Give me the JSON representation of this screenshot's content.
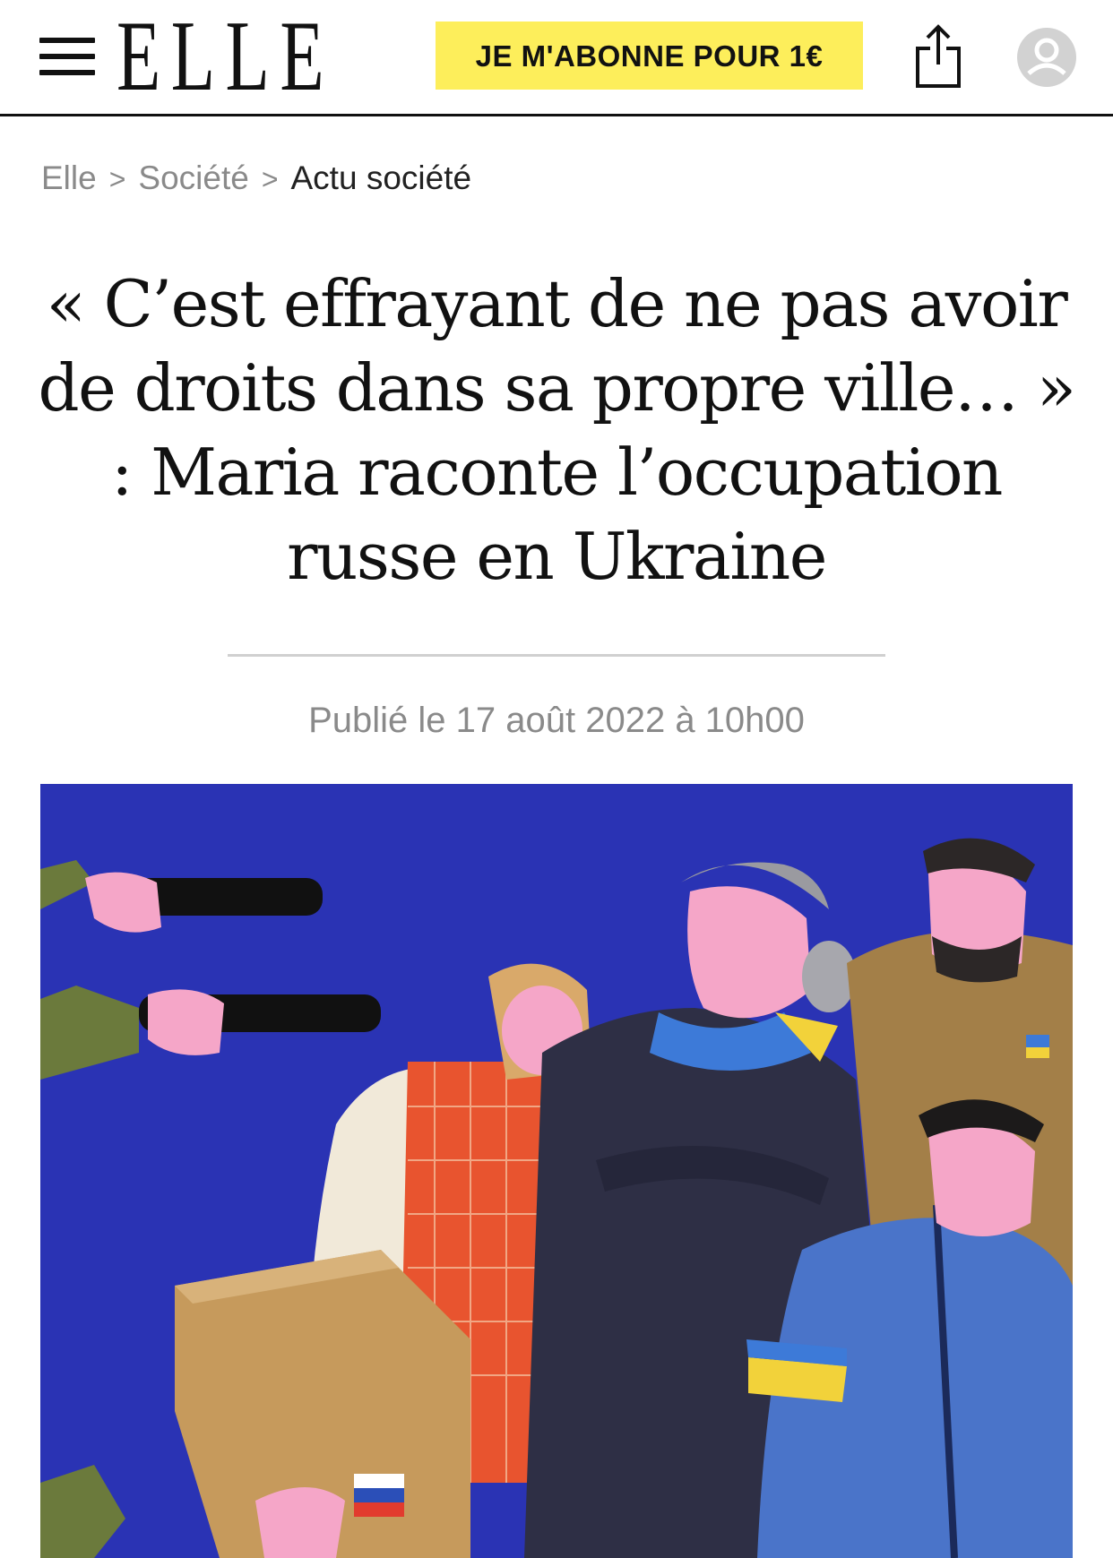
{
  "header": {
    "logo_text": "ELLE",
    "subscribe_label": "JE M'ABONNE POUR 1€",
    "menu_icon": "hamburger-menu-icon",
    "share_icon": "share-icon",
    "account_icon": "user-avatar-icon"
  },
  "breadcrumb": {
    "items": [
      "Elle",
      "Société",
      "Actu société"
    ],
    "separator": ">"
  },
  "article": {
    "title": "« C’est effrayant de ne pas avoir de droits dans sa propre ville… » : Maria raconte l’occupation russe en Ukraine",
    "published": "Publié le 17 août 2022 à 10h00"
  },
  "colors": {
    "accent_yellow": "#fdee5b",
    "illustration_background": "#2a33b4",
    "text": "#111111",
    "muted": "#8a8a8a"
  }
}
